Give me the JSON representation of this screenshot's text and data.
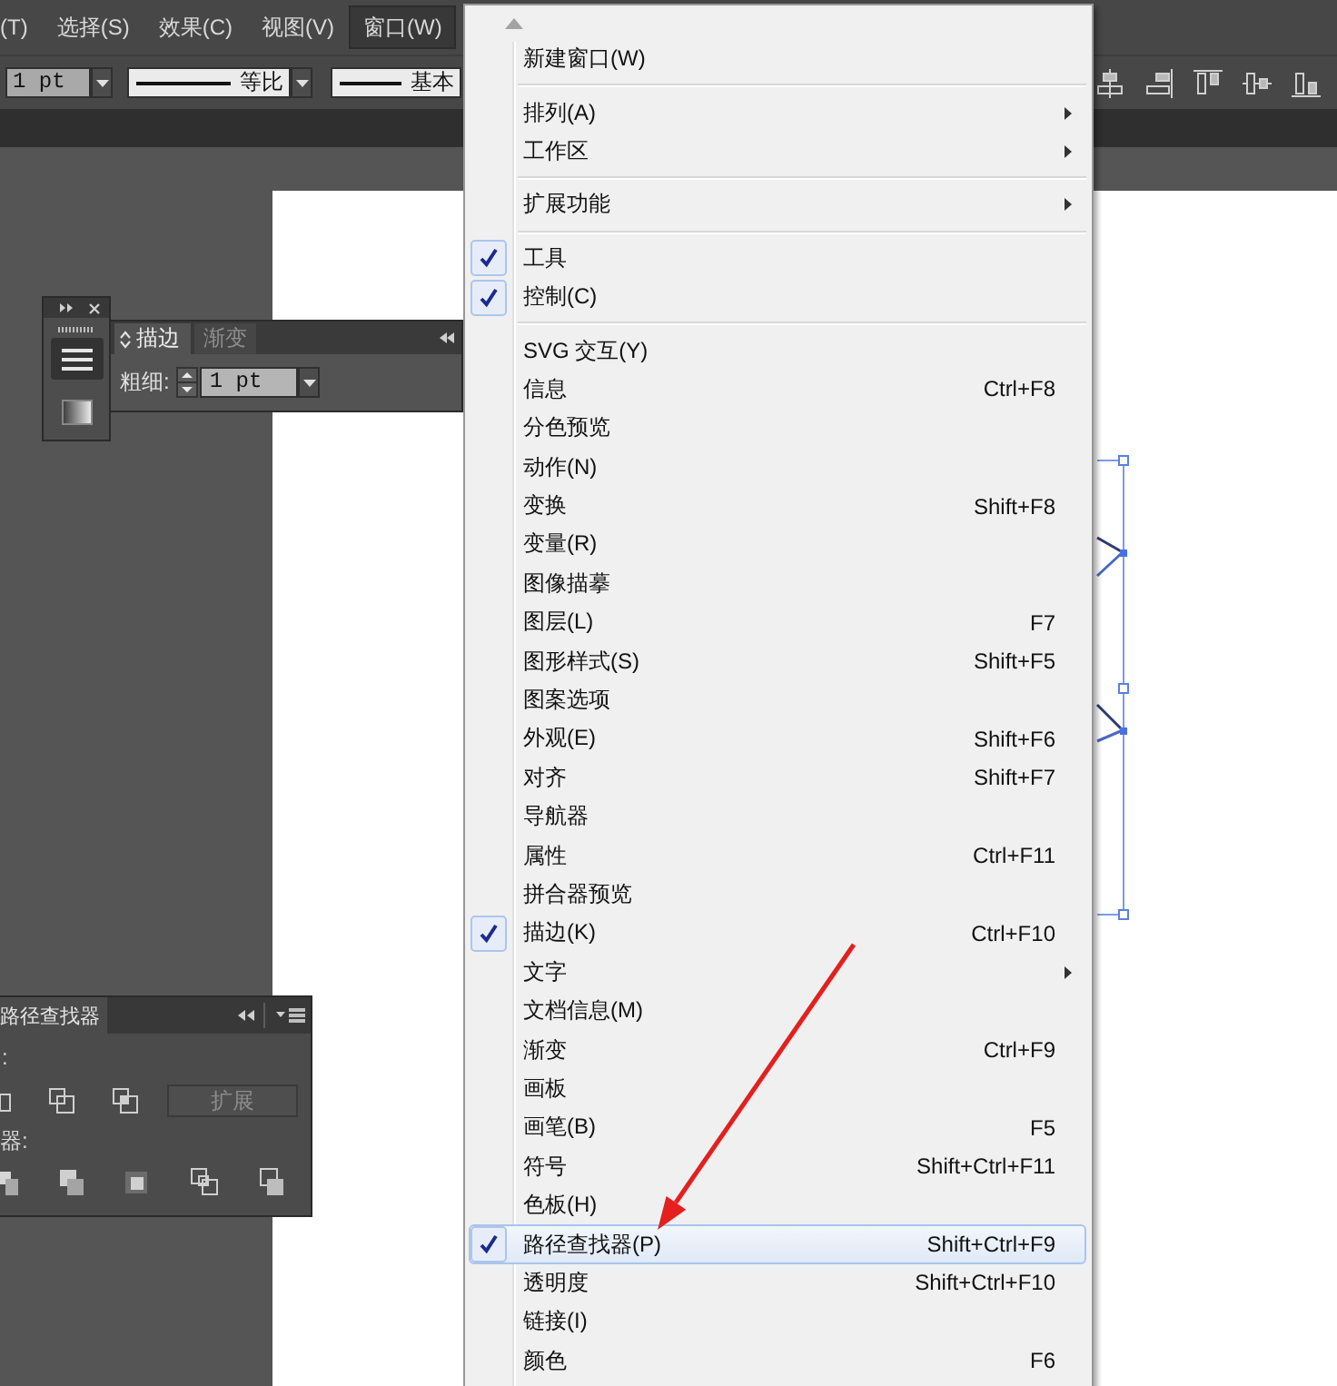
{
  "menu_bar": {
    "items": [
      {
        "label": "(T)",
        "selected": false
      },
      {
        "label": "选择(S)",
        "selected": false
      },
      {
        "label": "效果(C)",
        "selected": false
      },
      {
        "label": "视图(V)",
        "selected": false
      },
      {
        "label": "窗口(W)",
        "selected": true
      }
    ]
  },
  "control_bar": {
    "stroke_weight": "1 pt",
    "profiles": [
      {
        "label": "等比"
      },
      {
        "label": "基本"
      }
    ]
  },
  "stroke_panel": {
    "tabs": [
      {
        "label": "描边",
        "selected": true
      },
      {
        "label": "渐变",
        "selected": false
      }
    ],
    "weight_label": "粗细:",
    "weight_value": "1 pt"
  },
  "pathfinder_panel": {
    "tab": "路径查找器",
    "shape_modes_label": ":",
    "expand_button": {
      "label": "扩展",
      "disabled": true
    },
    "pathfinders_label": "器:"
  },
  "window_menu": {
    "items": [
      {
        "kind": "item",
        "label": "新建窗口(W)",
        "checked": false,
        "submenu": false,
        "highlighted": false
      },
      {
        "kind": "separator"
      },
      {
        "kind": "item",
        "label": "排列(A)",
        "checked": false,
        "submenu": true,
        "highlighted": false
      },
      {
        "kind": "item",
        "label": "工作区",
        "checked": false,
        "submenu": true,
        "highlighted": false
      },
      {
        "kind": "separator"
      },
      {
        "kind": "item",
        "label": "扩展功能",
        "checked": false,
        "submenu": true,
        "highlighted": false
      },
      {
        "kind": "separator"
      },
      {
        "kind": "item",
        "label": "工具",
        "checked": true,
        "submenu": false,
        "highlighted": false
      },
      {
        "kind": "item",
        "label": "控制(C)",
        "checked": true,
        "submenu": false,
        "highlighted": false
      },
      {
        "kind": "separator"
      },
      {
        "kind": "item",
        "label": "SVG 交互(Y)",
        "checked": false,
        "submenu": false,
        "highlighted": false
      },
      {
        "kind": "item",
        "label": "信息",
        "shortcut": "Ctrl+F8",
        "checked": false,
        "submenu": false,
        "highlighted": false
      },
      {
        "kind": "item",
        "label": "分色预览",
        "checked": false,
        "submenu": false,
        "highlighted": false
      },
      {
        "kind": "item",
        "label": "动作(N)",
        "checked": false,
        "submenu": false,
        "highlighted": false
      },
      {
        "kind": "item",
        "label": "变换",
        "shortcut": "Shift+F8",
        "checked": false,
        "submenu": false,
        "highlighted": false
      },
      {
        "kind": "item",
        "label": "变量(R)",
        "checked": false,
        "submenu": false,
        "highlighted": false
      },
      {
        "kind": "item",
        "label": "图像描摹",
        "checked": false,
        "submenu": false,
        "highlighted": false
      },
      {
        "kind": "item",
        "label": "图层(L)",
        "shortcut": "F7",
        "checked": false,
        "submenu": false,
        "highlighted": false
      },
      {
        "kind": "item",
        "label": "图形样式(S)",
        "shortcut": "Shift+F5",
        "checked": false,
        "submenu": false,
        "highlighted": false
      },
      {
        "kind": "item",
        "label": "图案选项",
        "checked": false,
        "submenu": false,
        "highlighted": false
      },
      {
        "kind": "item",
        "label": "外观(E)",
        "shortcut": "Shift+F6",
        "checked": false,
        "submenu": false,
        "highlighted": false
      },
      {
        "kind": "item",
        "label": "对齐",
        "shortcut": "Shift+F7",
        "checked": false,
        "submenu": false,
        "highlighted": false
      },
      {
        "kind": "item",
        "label": "导航器",
        "checked": false,
        "submenu": false,
        "highlighted": false
      },
      {
        "kind": "item",
        "label": "属性",
        "shortcut": "Ctrl+F11",
        "checked": false,
        "submenu": false,
        "highlighted": false
      },
      {
        "kind": "item",
        "label": "拼合器预览",
        "checked": false,
        "submenu": false,
        "highlighted": false
      },
      {
        "kind": "item",
        "label": "描边(K)",
        "shortcut": "Ctrl+F10",
        "checked": true,
        "submenu": false,
        "highlighted": false
      },
      {
        "kind": "item",
        "label": "文字",
        "checked": false,
        "submenu": true,
        "highlighted": false
      },
      {
        "kind": "item",
        "label": "文档信息(M)",
        "checked": false,
        "submenu": false,
        "highlighted": false
      },
      {
        "kind": "item",
        "label": "渐变",
        "shortcut": "Ctrl+F9",
        "checked": false,
        "submenu": false,
        "highlighted": false
      },
      {
        "kind": "item",
        "label": "画板",
        "checked": false,
        "submenu": false,
        "highlighted": false
      },
      {
        "kind": "item",
        "label": "画笔(B)",
        "shortcut": "F5",
        "checked": false,
        "submenu": false,
        "highlighted": false
      },
      {
        "kind": "item",
        "label": "符号",
        "shortcut": "Shift+Ctrl+F11",
        "checked": false,
        "submenu": false,
        "highlighted": false
      },
      {
        "kind": "item",
        "label": "色板(H)",
        "checked": false,
        "submenu": false,
        "highlighted": false
      },
      {
        "kind": "item",
        "label": "路径查找器(P)",
        "shortcut": "Shift+Ctrl+F9",
        "checked": true,
        "submenu": false,
        "highlighted": true
      },
      {
        "kind": "item",
        "label": "透明度",
        "shortcut": "Shift+Ctrl+F10",
        "checked": false,
        "submenu": false,
        "highlighted": false
      },
      {
        "kind": "item",
        "label": "链接(I)",
        "checked": false,
        "submenu": false,
        "highlighted": false
      },
      {
        "kind": "item",
        "label": "颜色",
        "shortcut": "F6",
        "checked": false,
        "submenu": false,
        "highlighted": false
      }
    ]
  }
}
